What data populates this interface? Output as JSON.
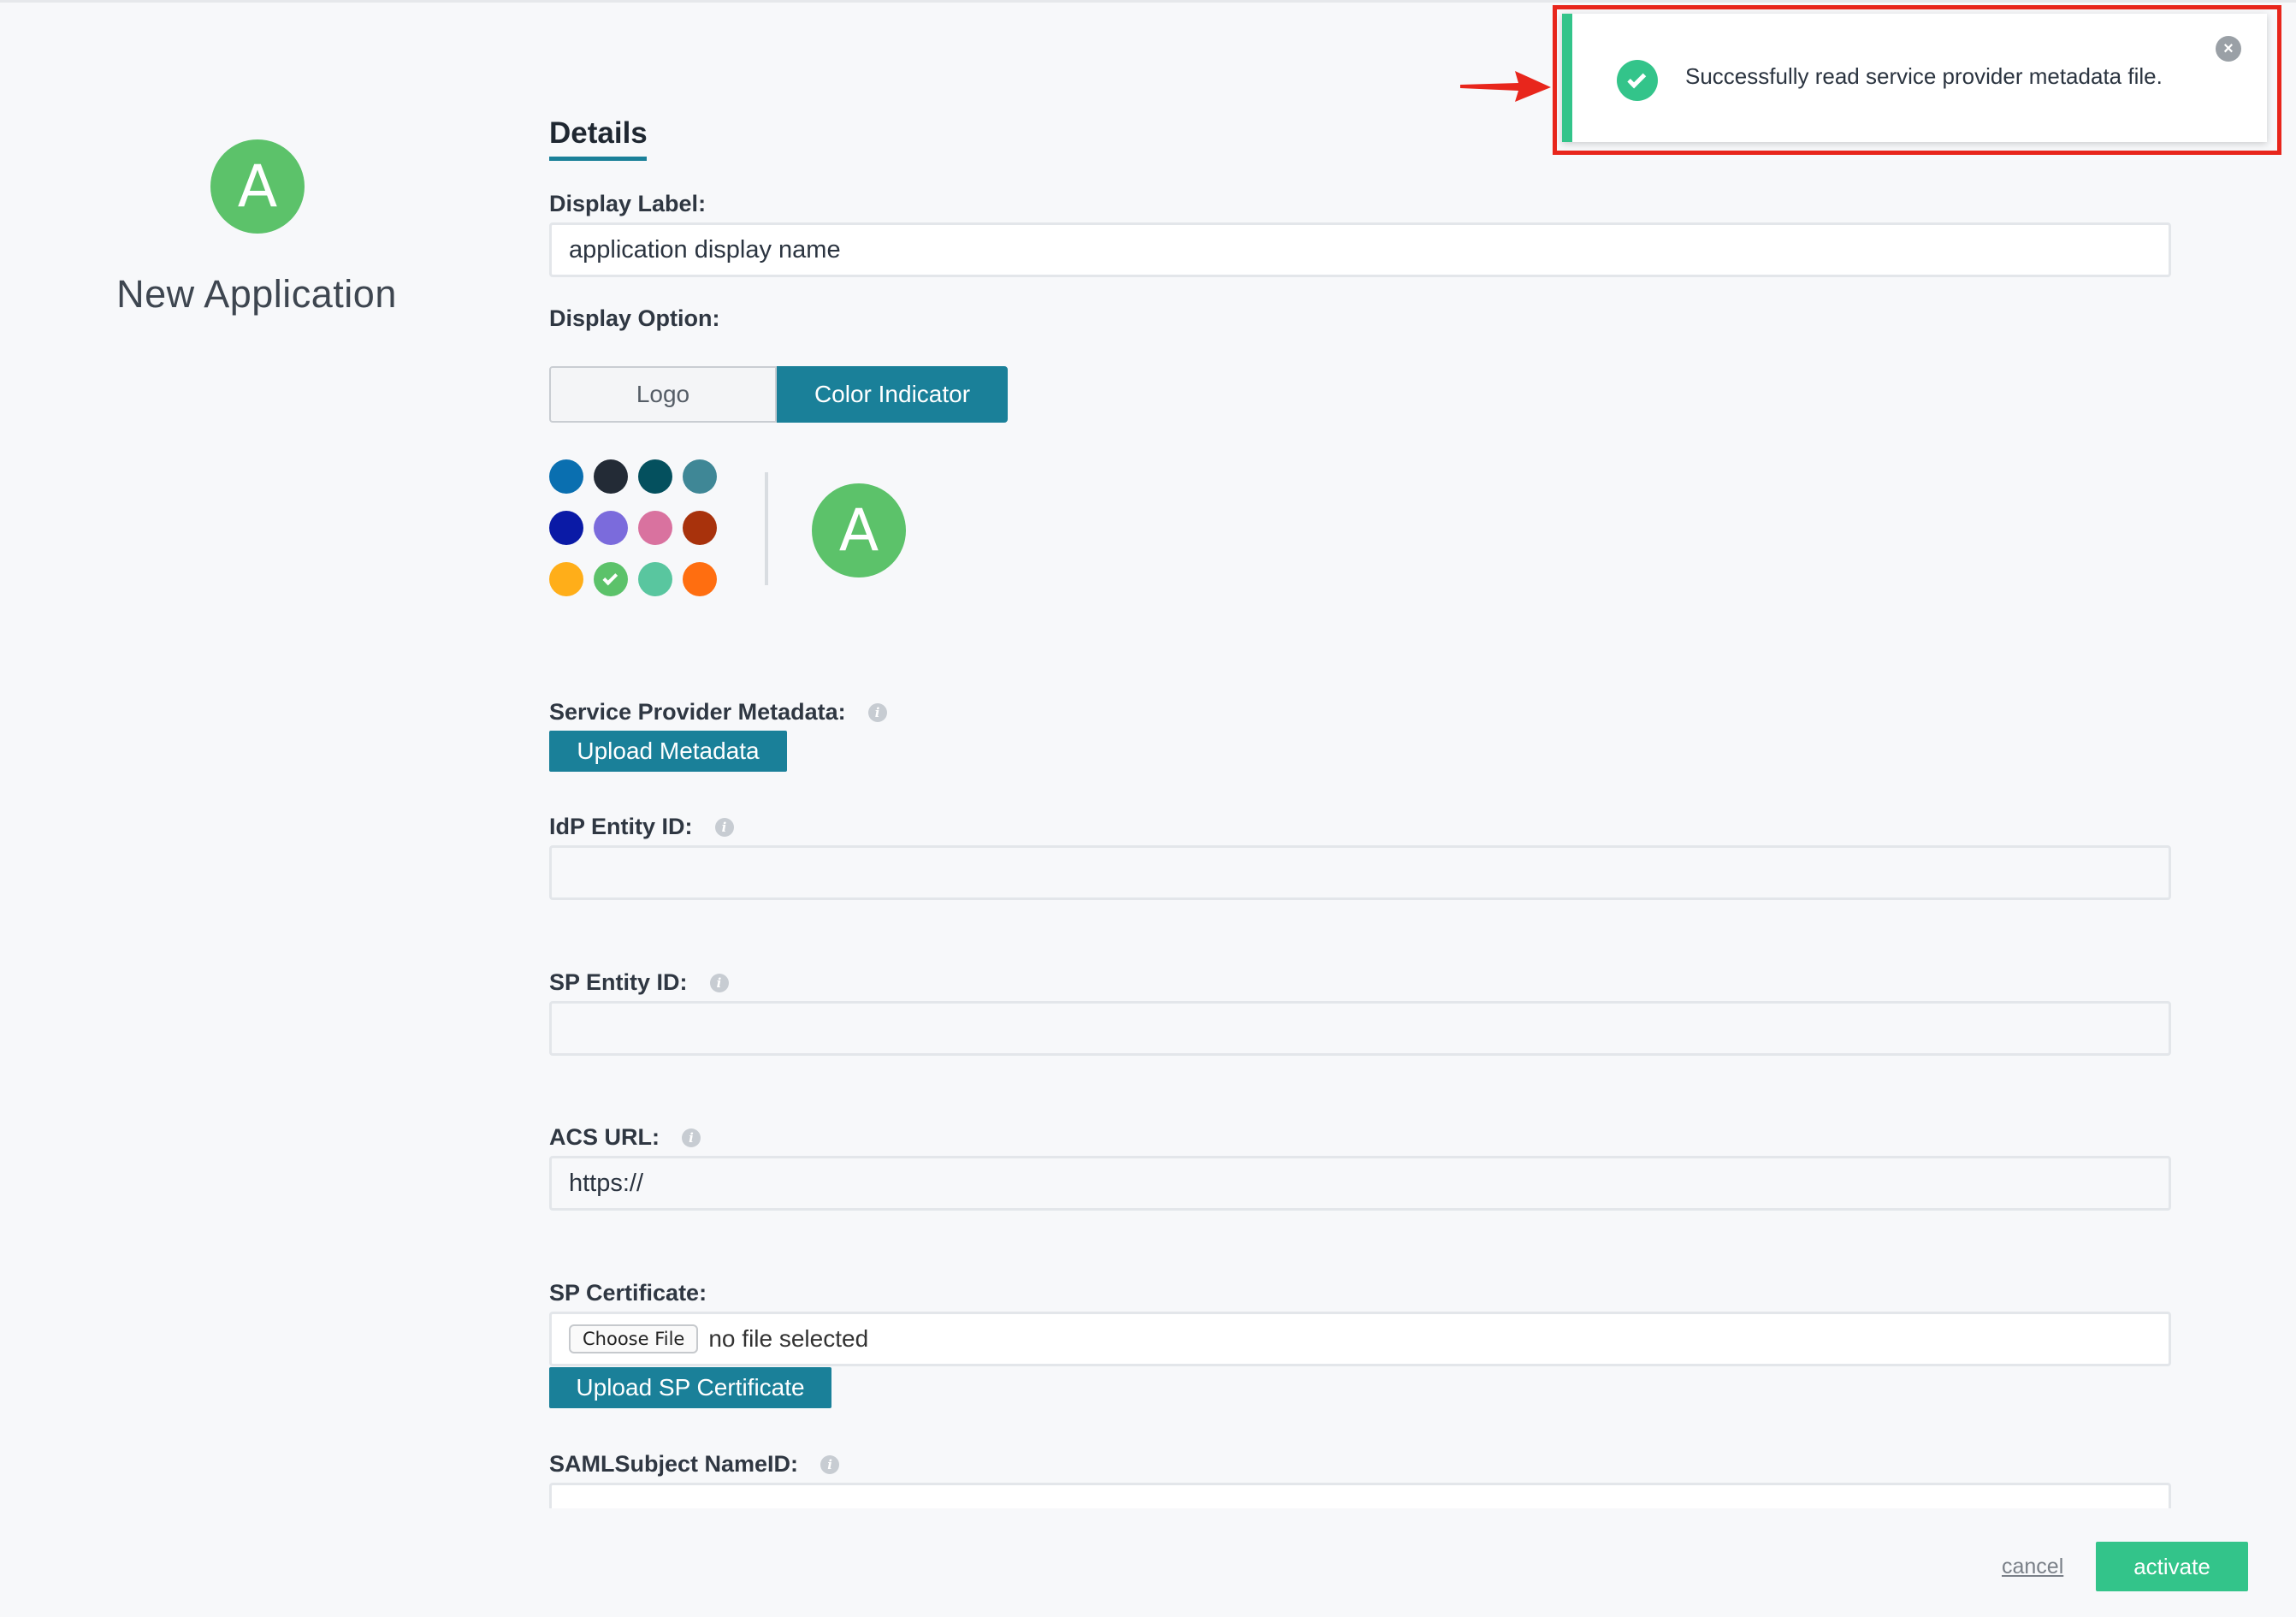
{
  "app": {
    "avatar_letter": "A",
    "title": "New Application"
  },
  "details": {
    "section_title": "Details",
    "display_label": {
      "label": "Display Label:",
      "value": "application display name"
    },
    "display_option": {
      "label": "Display Option:",
      "options": [
        "Logo",
        "Color Indicator"
      ],
      "selected": "Color Indicator"
    },
    "colors": [
      "#0a6fb0",
      "#232b36",
      "#04505e",
      "#3f8796",
      "#0a1aa6",
      "#7b6bdc",
      "#d9729f",
      "#a8320c",
      "#ffae19",
      "#5cc26a",
      "#59c69f",
      "#ff6e10"
    ],
    "selected_color": "#5cc26a",
    "preview_letter": "A",
    "service_provider_metadata": {
      "label": "Service Provider Metadata:",
      "button": "Upload Metadata"
    },
    "idp_entity_id": {
      "label": "IdP Entity ID:",
      "value": ""
    },
    "sp_entity_id": {
      "label": "SP Entity ID:",
      "value": ""
    },
    "acs_url": {
      "label": "ACS URL:",
      "value": "https://"
    },
    "sp_certificate": {
      "label": "SP Certificate:",
      "choose_file": "Choose File",
      "file_status": "no file selected",
      "button": "Upload SP Certificate"
    },
    "saml_subject_nameid": {
      "label": "SAMLSubject NameID:"
    }
  },
  "footer": {
    "cancel": "cancel",
    "activate": "activate"
  },
  "toast": {
    "message": "Successfully read service provider metadata file.",
    "close": "×",
    "accent": "#33c48a",
    "highlight": "#e8261c"
  },
  "info_glyph": "i"
}
